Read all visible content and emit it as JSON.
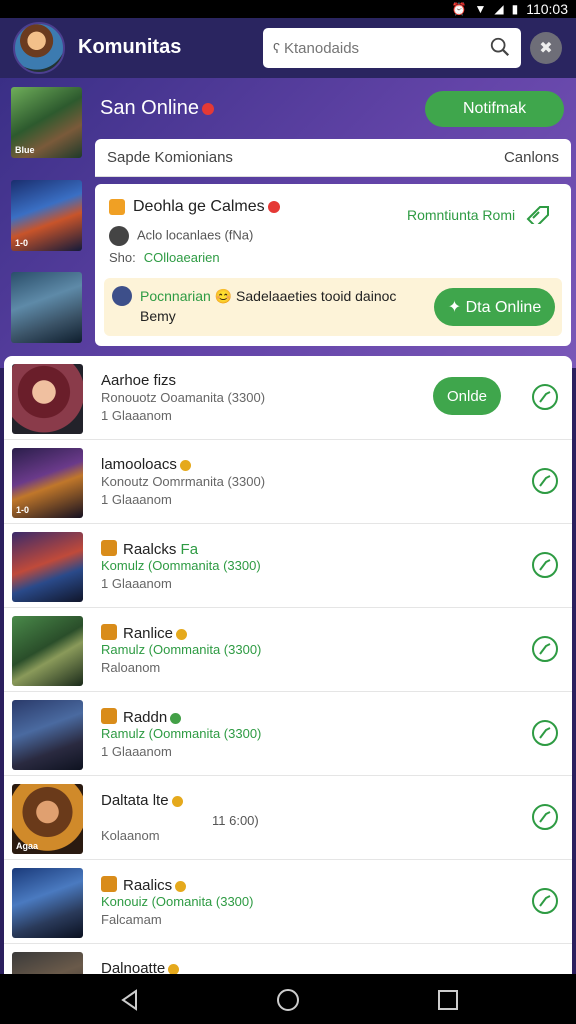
{
  "status_bar": {
    "time": "110:03"
  },
  "header": {
    "title": "Komunitas",
    "search_placeholder": "Ktanodaids"
  },
  "featured": {
    "title": "San Online",
    "notify_label": "Notifmak"
  },
  "card": {
    "head_left": "Sapde Komionians",
    "head_right": "Canlons",
    "title": "Deohla ge Calmes",
    "link": "Romntiunta Romi",
    "line2": "Aclo locanlaes (fNa)",
    "line3_key": "Sho:",
    "line3_value": "COlloaearien",
    "promo_green": "Pocnnarian",
    "promo_rest": "Sadelaaeties tooid dainoc",
    "promo_line2": "Bemy",
    "play_label": "Dta Online"
  },
  "rows": [
    {
      "name": "Aarhoe fizs",
      "sub": "Ronouotz Ooamanita (3300)",
      "meta": "1 Glaaanom",
      "button": "Onlde",
      "thumb": ""
    },
    {
      "name": "lamooloacs",
      "sub": "Konoutz Oomrmanita (3300)",
      "meta": "1 Glaaanom",
      "thumb": "1-0"
    },
    {
      "name": "Raalcks",
      "tag": "Fa",
      "sub": "Komulz (Oommanita (3300)",
      "meta": "1 Glaaanom",
      "thumb": ""
    },
    {
      "name": "Ranlice",
      "sub": "Ramulz (Oommanita (3300)",
      "meta": "Raloanom",
      "thumb": ""
    },
    {
      "name": "Raddn",
      "sub": "Ramulz (Oommanita (3300)",
      "meta": "1 Glaaanom",
      "thumb": ""
    },
    {
      "name": "Daltata lte",
      "sub": "11 6:00)",
      "meta": "Kolaanom",
      "thumb": "Agaa"
    },
    {
      "name": "Raalics",
      "sub": "Konouiz (Oomanita (3300)",
      "meta": "Falcamam",
      "thumb": ""
    },
    {
      "name": "Dalnoatte",
      "sub": "",
      "meta": "",
      "thumb": ""
    }
  ],
  "left_thumbs": [
    "Blue",
    "1-0",
    ""
  ],
  "colors": {
    "accent_green": "#3fa64c",
    "header_bg": "#2a2560",
    "purple": "#6344a8"
  }
}
